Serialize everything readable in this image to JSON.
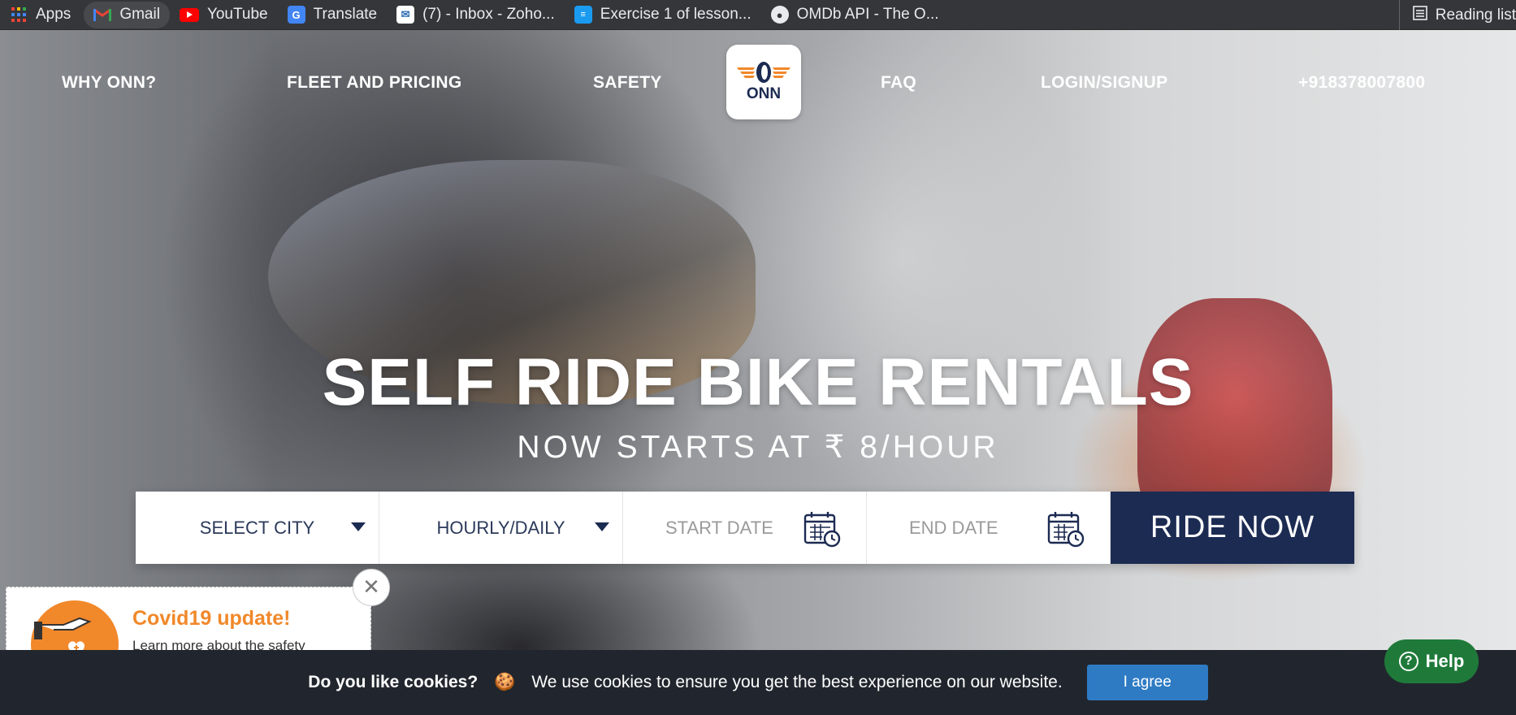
{
  "bookmarks": {
    "items": [
      {
        "label": "Apps",
        "icon": "apps-grid-icon"
      },
      {
        "label": "Gmail",
        "icon": "gmail-icon"
      },
      {
        "label": "YouTube",
        "icon": "youtube-icon"
      },
      {
        "label": "Translate",
        "icon": "translate-icon"
      },
      {
        "label": "(7) - Inbox - Zoho...",
        "icon": "zoho-icon"
      },
      {
        "label": "Exercise 1 of lesson...",
        "icon": "document-icon"
      },
      {
        "label": "OMDb API - The O...",
        "icon": "omdb-icon"
      }
    ],
    "reading_list": "Reading list"
  },
  "nav": {
    "why": "WHY ONN?",
    "fleet": "FLEET AND PRICING",
    "safety": "SAFETY",
    "logo_text": "ONN",
    "faq": "FAQ",
    "login": "LOGIN/SIGNUP",
    "phone": "+918378007800"
  },
  "hero": {
    "headline": "SELF RIDE BIKE RENTALS",
    "subheadline": "NOW STARTS AT ₹ 8/HOUR"
  },
  "booking": {
    "city": "SELECT CITY",
    "duration": "HOURLY/DAILY",
    "start": "START DATE",
    "end": "END DATE",
    "cta": "RIDE NOW"
  },
  "covid": {
    "title": "Covid19 update!",
    "body": "Learn more about the safety"
  },
  "cookie": {
    "question": "Do you like cookies?",
    "emoji": "🍪",
    "message": "We use cookies to ensure you get the best experience on our website.",
    "button": "I agree"
  },
  "help": {
    "label": "Help"
  },
  "colors": {
    "brand_navy": "#1c2b52",
    "brand_orange": "#f1882a",
    "cookie_button": "#2e7bc4",
    "help_green": "#1f7a3a"
  }
}
